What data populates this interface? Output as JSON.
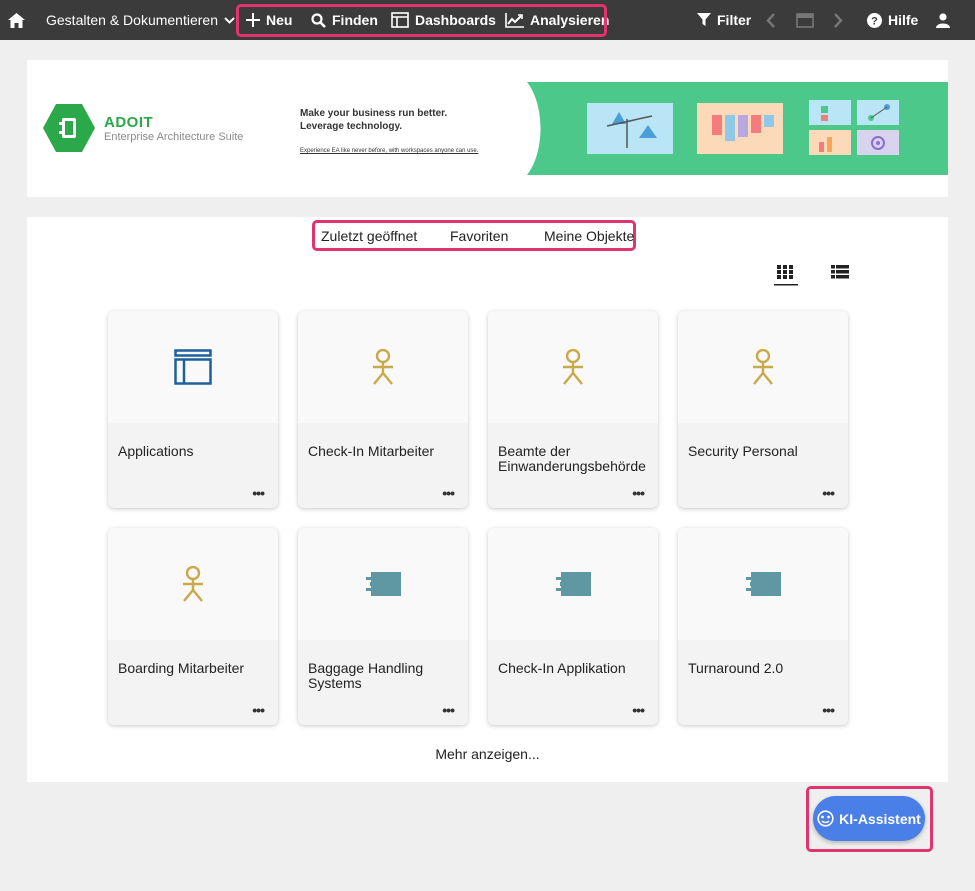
{
  "topbar": {
    "menu_label": "Gestalten & Dokumentieren",
    "new_label": "Neu",
    "find_label": "Finden",
    "dashboards_label": "Dashboards",
    "analyze_label": "Analysieren",
    "filter_label": "Filter",
    "help_label": "Hilfe"
  },
  "banner": {
    "brand": "ADOIT",
    "suite": "Enterprise Architecture Suite",
    "tagline1": "Make your business run better.",
    "tagline2": "Leverage technology.",
    "tagline3": "Experience EA like never before, with workspaces anyone can use."
  },
  "tabs": {
    "recent": "Zuletzt geöffnet",
    "favorites": "Favoriten",
    "my_objects": "Meine Objekte"
  },
  "tiles": [
    {
      "label": "Applications",
      "icon": "dashboard-layout-icon"
    },
    {
      "label": "Check-In Mitarbeiter",
      "icon": "person-icon"
    },
    {
      "label": "Beamte der Einwanderungsbehörde",
      "icon": "person-icon"
    },
    {
      "label": "Security Personal",
      "icon": "person-icon"
    },
    {
      "label": "Boarding Mitarbeiter",
      "icon": "person-icon"
    },
    {
      "label": "Baggage Handling Systems",
      "icon": "component-icon"
    },
    {
      "label": "Check-In Applikation",
      "icon": "component-icon"
    },
    {
      "label": "Turnaround 2.0",
      "icon": "component-icon"
    }
  ],
  "more_label": "Mehr anzeigen...",
  "assistant_label": "KI-Assistent",
  "colors": {
    "accent_highlight": "#e0336f",
    "brand_green": "#2aa84a",
    "person_icon": "#c9a94a",
    "layout_icon": "#1f5f9a",
    "component_icon": "#5f97a3",
    "assistant_button": "#4a7fe8"
  }
}
